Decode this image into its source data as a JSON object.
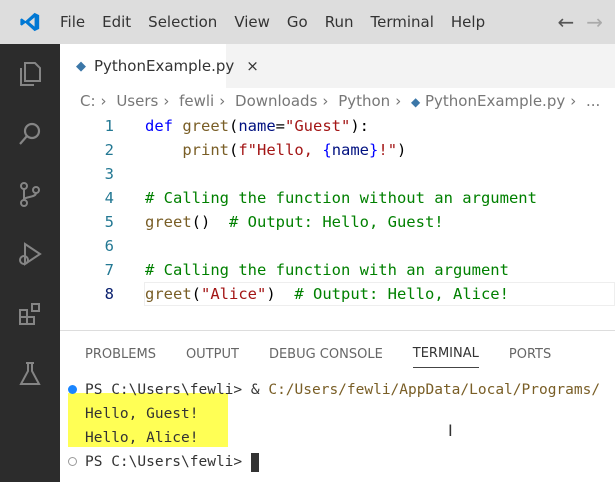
{
  "menubar": {
    "items": [
      "File",
      "Edit",
      "Selection",
      "View",
      "Go",
      "Run",
      "Terminal",
      "Help"
    ]
  },
  "tab": {
    "label": "PythonExample.py",
    "close": "×"
  },
  "breadcrumb": [
    "C:",
    "Users",
    "fewli",
    "Downloads",
    "Python",
    "PythonExample.py",
    "..."
  ],
  "code": [
    {
      "n": "1",
      "tokens": [
        [
          "def ",
          "#0000ff"
        ],
        [
          "greet",
          "#795e26"
        ],
        [
          "(",
          "#000"
        ],
        [
          "name",
          "#001080"
        ],
        [
          "=",
          "#000"
        ],
        [
          "\"Guest\"",
          "#a31515"
        ],
        [
          "):",
          "#000"
        ]
      ]
    },
    {
      "n": "2",
      "tokens": [
        [
          "    ",
          "#000"
        ],
        [
          "print",
          "#795e26"
        ],
        [
          "(",
          "#000"
        ],
        [
          "f\"Hello, ",
          "#a31515"
        ],
        [
          "{",
          "#0000ff"
        ],
        [
          "name",
          "#001080"
        ],
        [
          "}",
          "#0000ff"
        ],
        [
          "!\"",
          "#a31515"
        ],
        [
          ")",
          "#000"
        ]
      ]
    },
    {
      "n": "3",
      "tokens": []
    },
    {
      "n": "4",
      "tokens": [
        [
          "# Calling the function without an argument",
          "#008000"
        ]
      ]
    },
    {
      "n": "5",
      "tokens": [
        [
          "greet",
          "#795e26"
        ],
        [
          "()  ",
          "#000"
        ],
        [
          "# Output: Hello, Guest!",
          "#008000"
        ]
      ]
    },
    {
      "n": "6",
      "tokens": []
    },
    {
      "n": "7",
      "tokens": [
        [
          "# Calling the function with an argument",
          "#008000"
        ]
      ]
    },
    {
      "n": "8",
      "tokens": [
        [
          "greet",
          "#795e26"
        ],
        [
          "(",
          "#000"
        ],
        [
          "\"Alice\"",
          "#a31515"
        ],
        [
          ")  ",
          "#000"
        ],
        [
          "# Output: Hello, Alice!",
          "#008000"
        ]
      ]
    }
  ],
  "panel": {
    "tabs": [
      "PROBLEMS",
      "OUTPUT",
      "DEBUG CONSOLE",
      "TERMINAL",
      "PORTS"
    ],
    "active": "TERMINAL"
  },
  "terminal": {
    "prompt": "PS C:\\Users\\fewli> ",
    "command_amp": "& ",
    "command_path": "C:/Users/fewli/AppData/Local/Programs/",
    "output": [
      "Hello, Guest!",
      "Hello, Alice!"
    ],
    "prompt2": "PS C:\\Users\\fewli> "
  },
  "colors": {
    "accent": "#0078d4",
    "highlight": "#ffff55",
    "path": "#795e26"
  }
}
